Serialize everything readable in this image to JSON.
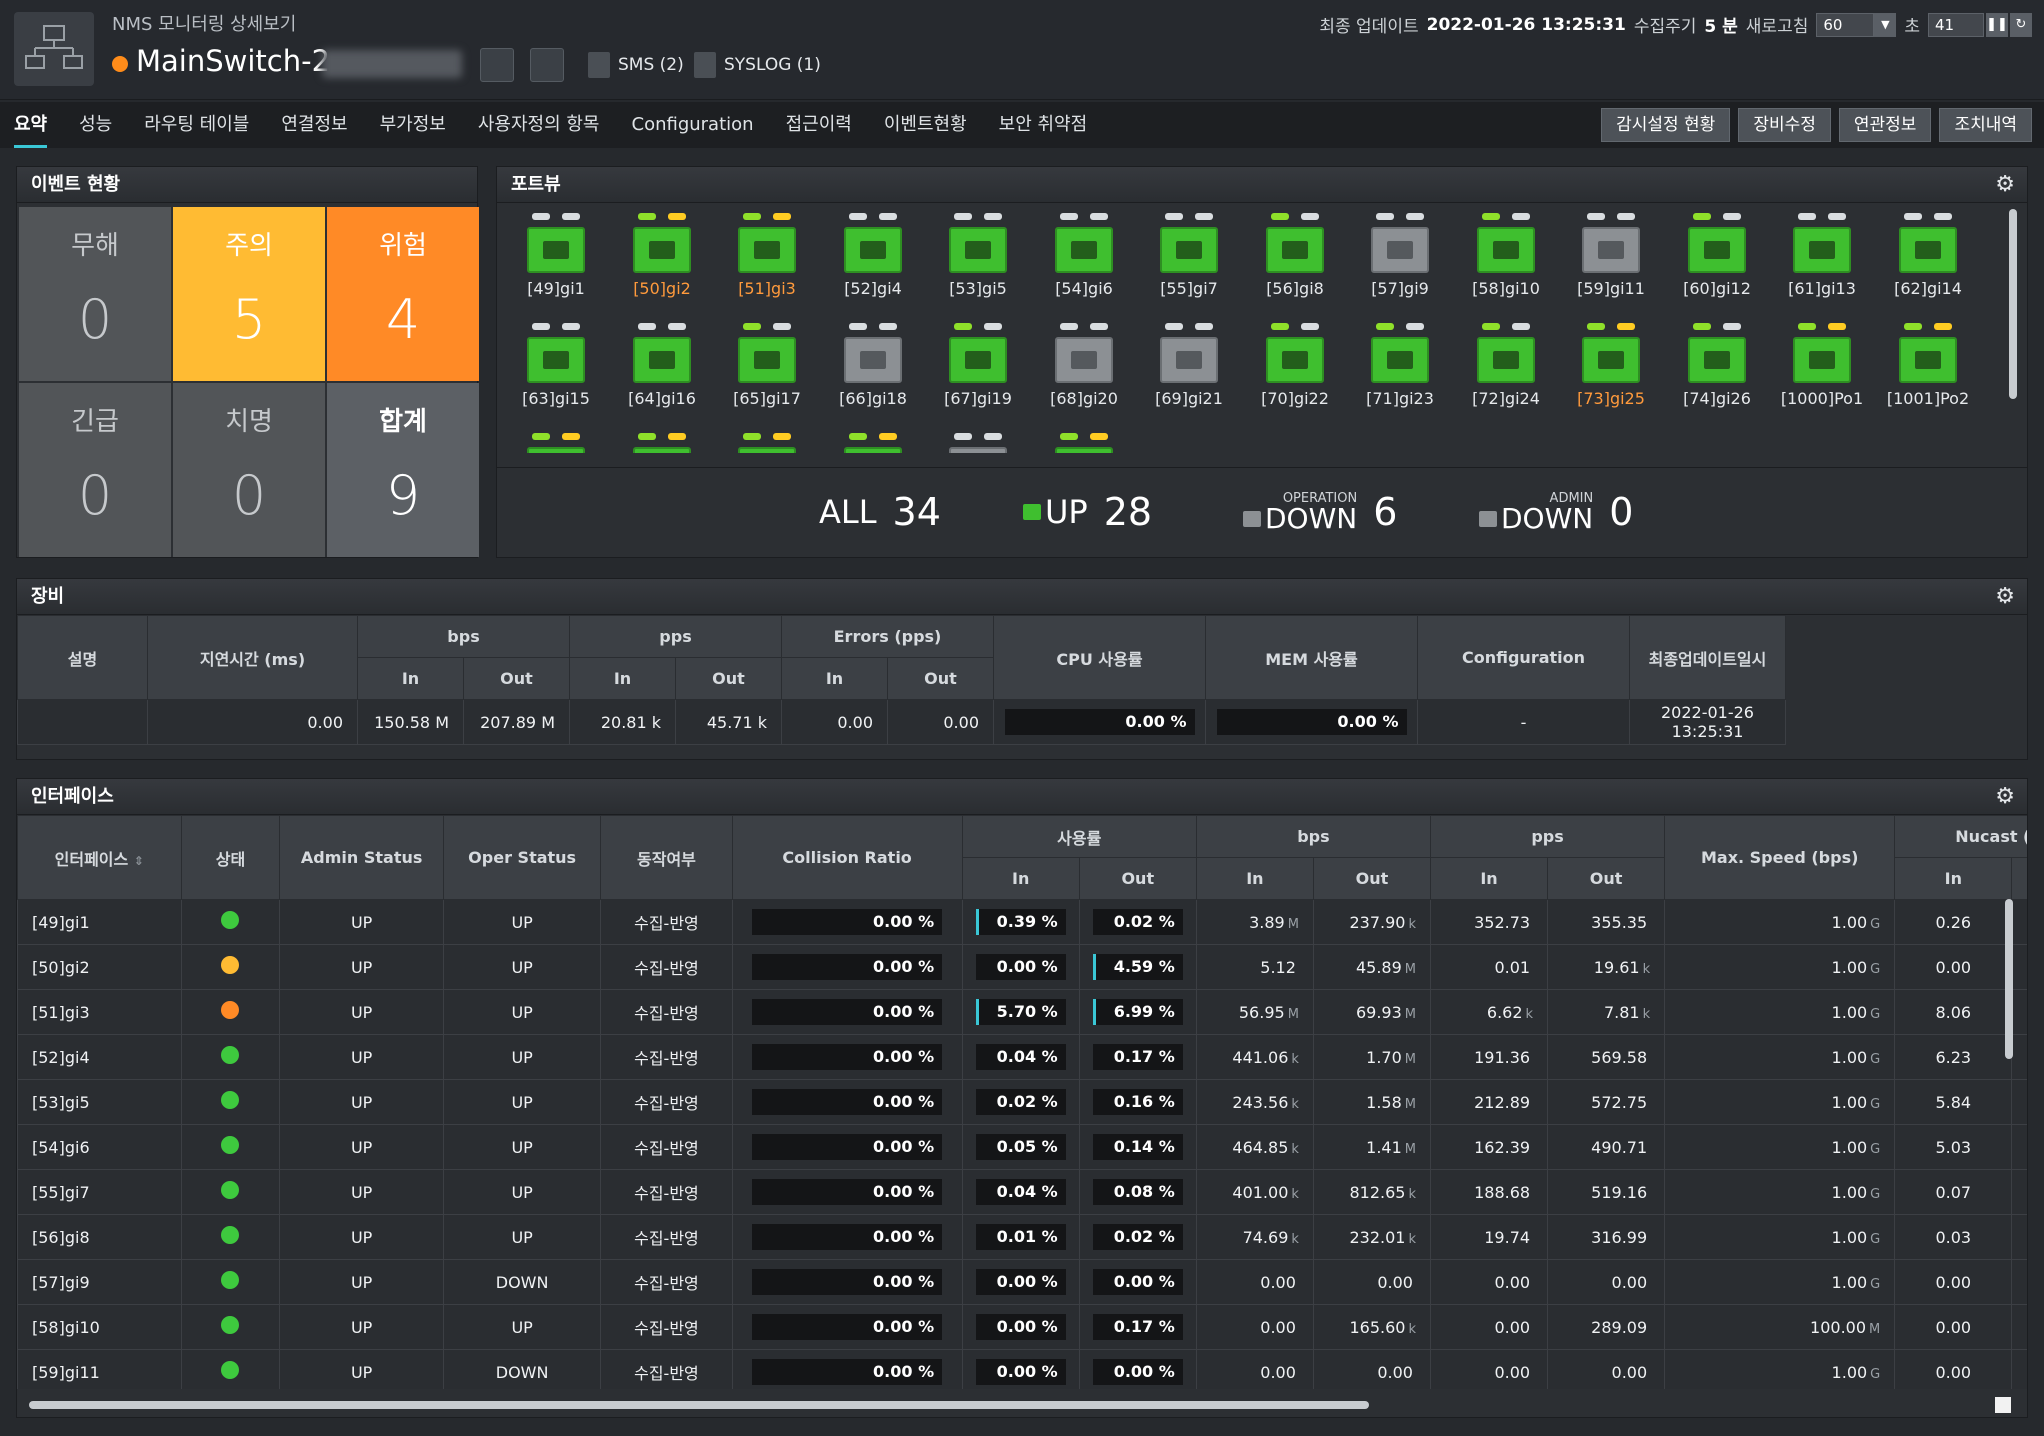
{
  "header": {
    "subtitle": "NMS 모니터링 상세보기",
    "device_name": "MainSwitch-2",
    "sms_label": "SMS (2)",
    "syslog_label": "SYSLOG (1)",
    "last_update_label": "최종 업데이트",
    "last_update_value": "2022-01-26 13:25:31",
    "collect_cycle_label": "수집주기",
    "collect_cycle_value": "5 분",
    "refresh_label": "새로고침",
    "refresh_value": "60",
    "seconds_label": "초",
    "countdown": "41",
    "status_color": "#ff8c1a"
  },
  "tabs": [
    {
      "label": "요약",
      "active": true
    },
    {
      "label": "성능"
    },
    {
      "label": "라우팅 테이블"
    },
    {
      "label": "연결정보"
    },
    {
      "label": "부가정보"
    },
    {
      "label": "사용자정의 항목"
    },
    {
      "label": "Configuration"
    },
    {
      "label": "접근이력"
    },
    {
      "label": "이벤트현황"
    },
    {
      "label": "보안 취약점"
    }
  ],
  "actions": [
    "감시설정 현황",
    "장비수정",
    "연관정보",
    "조치내역"
  ],
  "events": {
    "title": "이벤트 현황",
    "cells": [
      {
        "label": "무해",
        "value": "0"
      },
      {
        "label": "주의",
        "value": "5"
      },
      {
        "label": "위험",
        "value": "4"
      },
      {
        "label": "긴급",
        "value": "0"
      },
      {
        "label": "치명",
        "value": "0"
      },
      {
        "label": "합계",
        "value": "9"
      }
    ]
  },
  "portview": {
    "title": "포트뷰",
    "ports": [
      {
        "label": "[49]gi1",
        "leds": [
          "w",
          "w"
        ],
        "gray": false,
        "warn": false
      },
      {
        "label": "[50]gi2",
        "leds": [
          "g",
          "y"
        ],
        "gray": false,
        "warn": true
      },
      {
        "label": "[51]gi3",
        "leds": [
          "g",
          "y"
        ],
        "gray": false,
        "warn": true
      },
      {
        "label": "[52]gi4",
        "leds": [
          "w",
          "w"
        ],
        "gray": false,
        "warn": false
      },
      {
        "label": "[53]gi5",
        "leds": [
          "w",
          "w"
        ],
        "gray": false,
        "warn": false
      },
      {
        "label": "[54]gi6",
        "leds": [
          "w",
          "w"
        ],
        "gray": false,
        "warn": false
      },
      {
        "label": "[55]gi7",
        "leds": [
          "w",
          "w"
        ],
        "gray": false,
        "warn": false
      },
      {
        "label": "[56]gi8",
        "leds": [
          "g",
          "w"
        ],
        "gray": false,
        "warn": false
      },
      {
        "label": "[57]gi9",
        "leds": [
          "w",
          "w"
        ],
        "gray": true,
        "warn": false
      },
      {
        "label": "[58]gi10",
        "leds": [
          "g",
          "w"
        ],
        "gray": false,
        "warn": false
      },
      {
        "label": "[59]gi11",
        "leds": [
          "w",
          "w"
        ],
        "gray": true,
        "warn": false
      },
      {
        "label": "[60]gi12",
        "leds": [
          "g",
          "w"
        ],
        "gray": false,
        "warn": false
      },
      {
        "label": "[61]gi13",
        "leds": [
          "w",
          "w"
        ],
        "gray": false,
        "warn": false
      },
      {
        "label": "[62]gi14",
        "leds": [
          "w",
          "w"
        ],
        "gray": false,
        "warn": false
      },
      {
        "label": "[63]gi15",
        "leds": [
          "w",
          "w"
        ],
        "gray": false,
        "warn": false
      },
      {
        "label": "[64]gi16",
        "leds": [
          "w",
          "w"
        ],
        "gray": false,
        "warn": false
      },
      {
        "label": "[65]gi17",
        "leds": [
          "g",
          "w"
        ],
        "gray": false,
        "warn": false
      },
      {
        "label": "[66]gi18",
        "leds": [
          "w",
          "w"
        ],
        "gray": true,
        "warn": false
      },
      {
        "label": "[67]gi19",
        "leds": [
          "g",
          "w"
        ],
        "gray": false,
        "warn": false
      },
      {
        "label": "[68]gi20",
        "leds": [
          "w",
          "w"
        ],
        "gray": true,
        "warn": false
      },
      {
        "label": "[69]gi21",
        "leds": [
          "w",
          "w"
        ],
        "gray": true,
        "warn": false
      },
      {
        "label": "[70]gi22",
        "leds": [
          "g",
          "w"
        ],
        "gray": false,
        "warn": false
      },
      {
        "label": "[71]gi23",
        "leds": [
          "g",
          "w"
        ],
        "gray": false,
        "warn": false
      },
      {
        "label": "[72]gi24",
        "leds": [
          "g",
          "w"
        ],
        "gray": false,
        "warn": false
      },
      {
        "label": "[73]gi25",
        "leds": [
          "g",
          "y"
        ],
        "gray": false,
        "warn": true
      },
      {
        "label": "[74]gi26",
        "leds": [
          "g",
          "w"
        ],
        "gray": false,
        "warn": false
      },
      {
        "label": "[1000]Po1",
        "leds": [
          "g",
          "y"
        ],
        "gray": false,
        "warn": false
      },
      {
        "label": "[1001]Po2",
        "leds": [
          "g",
          "y"
        ],
        "gray": false,
        "warn": false
      },
      {
        "label": "",
        "leds": [
          "g",
          "y"
        ],
        "gray": false,
        "warn": false
      },
      {
        "label": "",
        "leds": [
          "g",
          "y"
        ],
        "gray": false,
        "warn": false
      },
      {
        "label": "",
        "leds": [
          "g",
          "y"
        ],
        "gray": false,
        "warn": false
      },
      {
        "label": "",
        "leds": [
          "g",
          "y"
        ],
        "gray": false,
        "warn": false
      },
      {
        "label": "",
        "leds": [
          "w",
          "w"
        ],
        "gray": true,
        "warn": false
      },
      {
        "label": "",
        "leds": [
          "g",
          "y"
        ],
        "gray": false,
        "warn": false
      }
    ],
    "summary": {
      "all_label": "ALL",
      "all_value": "34",
      "up_label": "UP",
      "up_value": "28",
      "op_small": "OPERATION",
      "op_label": "DOWN",
      "op_value": "6",
      "admin_small": "ADMIN",
      "admin_label": "DOWN",
      "admin_value": "0"
    }
  },
  "equipment": {
    "title": "장비",
    "headers": {
      "desc": "설명",
      "latency": "지연시간 (ms)",
      "bps": "bps",
      "pps": "pps",
      "errors": "Errors (pps)",
      "in": "In",
      "out": "Out",
      "cpu": "CPU 사용률",
      "mem": "MEM 사용률",
      "config": "Configuration",
      "updated": "최종업데이트일시"
    },
    "row": {
      "desc": "",
      "latency": "0.00",
      "bps_in": "150.58 M",
      "bps_out": "207.89 M",
      "pps_in": "20.81 k",
      "pps_out": "45.71 k",
      "err_in": "0.00",
      "err_out": "0.00",
      "cpu": "0.00 %",
      "mem": "0.00 %",
      "config": "-",
      "updated": "2022-01-26 13:25:31"
    }
  },
  "interfaces": {
    "title": "인터페이스",
    "headers": {
      "iface": "인터페이스",
      "status": "상태",
      "admin": "Admin Status",
      "oper": "Oper Status",
      "action": "동작여부",
      "collision": "Collision Ratio",
      "usage": "사용률",
      "bps": "bps",
      "pps": "pps",
      "maxspeed": "Max. Speed (bps)",
      "nucast": "Nucast (p",
      "in": "In",
      "out": "Out"
    },
    "sort_icon": "sort-arrows-icon",
    "rows": [
      {
        "name": "[49]gi1",
        "status": "#3ec93e",
        "admin": "UP",
        "oper": "UP",
        "action": "수집-반영",
        "collision": "0.00 %",
        "use_in": "0.39 %",
        "use_in_pct": 0.39,
        "use_out": "0.02 %",
        "use_out_pct": 0.02,
        "bps_in": "3.89",
        "bps_in_u": "M",
        "bps_out": "237.90",
        "bps_out_u": "k",
        "pps_in": "352.73",
        "pps_in_u": "",
        "pps_out": "355.35",
        "pps_out_u": "",
        "max": "1.00",
        "max_u": "G",
        "nucast_in": "0.26"
      },
      {
        "name": "[50]gi2",
        "status": "#ffbb33",
        "admin": "UP",
        "oper": "UP",
        "action": "수집-반영",
        "collision": "0.00 %",
        "use_in": "0.00 %",
        "use_in_pct": 0,
        "use_out": "4.59 %",
        "use_out_pct": 4.59,
        "bps_in": "5.12",
        "bps_in_u": "",
        "bps_out": "45.89",
        "bps_out_u": "M",
        "pps_in": "0.01",
        "pps_in_u": "",
        "pps_out": "19.61",
        "pps_out_u": "k",
        "max": "1.00",
        "max_u": "G",
        "nucast_in": "0.00"
      },
      {
        "name": "[51]gi3",
        "status": "#ff8a26",
        "admin": "UP",
        "oper": "UP",
        "action": "수집-반영",
        "collision": "0.00 %",
        "use_in": "5.70 %",
        "use_in_pct": 5.7,
        "use_out": "6.99 %",
        "use_out_pct": 6.99,
        "bps_in": "56.95",
        "bps_in_u": "M",
        "bps_out": "69.93",
        "bps_out_u": "M",
        "pps_in": "6.62",
        "pps_in_u": "k",
        "pps_out": "7.81",
        "pps_out_u": "k",
        "max": "1.00",
        "max_u": "G",
        "nucast_in": "8.06"
      },
      {
        "name": "[52]gi4",
        "status": "#3ec93e",
        "admin": "UP",
        "oper": "UP",
        "action": "수집-반영",
        "collision": "0.00 %",
        "use_in": "0.04 %",
        "use_in_pct": 0.04,
        "use_out": "0.17 %",
        "use_out_pct": 0.17,
        "bps_in": "441.06",
        "bps_in_u": "k",
        "bps_out": "1.70",
        "bps_out_u": "M",
        "pps_in": "191.36",
        "pps_in_u": "",
        "pps_out": "569.58",
        "pps_out_u": "",
        "max": "1.00",
        "max_u": "G",
        "nucast_in": "6.23"
      },
      {
        "name": "[53]gi5",
        "status": "#3ec93e",
        "admin": "UP",
        "oper": "UP",
        "action": "수집-반영",
        "collision": "0.00 %",
        "use_in": "0.02 %",
        "use_in_pct": 0.02,
        "use_out": "0.16 %",
        "use_out_pct": 0.16,
        "bps_in": "243.56",
        "bps_in_u": "k",
        "bps_out": "1.58",
        "bps_out_u": "M",
        "pps_in": "212.89",
        "pps_in_u": "",
        "pps_out": "572.75",
        "pps_out_u": "",
        "max": "1.00",
        "max_u": "G",
        "nucast_in": "5.84"
      },
      {
        "name": "[54]gi6",
        "status": "#3ec93e",
        "admin": "UP",
        "oper": "UP",
        "action": "수집-반영",
        "collision": "0.00 %",
        "use_in": "0.05 %",
        "use_in_pct": 0.05,
        "use_out": "0.14 %",
        "use_out_pct": 0.14,
        "bps_in": "464.85",
        "bps_in_u": "k",
        "bps_out": "1.41",
        "bps_out_u": "M",
        "pps_in": "162.39",
        "pps_in_u": "",
        "pps_out": "490.71",
        "pps_out_u": "",
        "max": "1.00",
        "max_u": "G",
        "nucast_in": "5.03"
      },
      {
        "name": "[55]gi7",
        "status": "#3ec93e",
        "admin": "UP",
        "oper": "UP",
        "action": "수집-반영",
        "collision": "0.00 %",
        "use_in": "0.04 %",
        "use_in_pct": 0.04,
        "use_out": "0.08 %",
        "use_out_pct": 0.08,
        "bps_in": "401.00",
        "bps_in_u": "k",
        "bps_out": "812.65",
        "bps_out_u": "k",
        "pps_in": "188.68",
        "pps_in_u": "",
        "pps_out": "519.16",
        "pps_out_u": "",
        "max": "1.00",
        "max_u": "G",
        "nucast_in": "0.07"
      },
      {
        "name": "[56]gi8",
        "status": "#3ec93e",
        "admin": "UP",
        "oper": "UP",
        "action": "수집-반영",
        "collision": "0.00 %",
        "use_in": "0.01 %",
        "use_in_pct": 0.01,
        "use_out": "0.02 %",
        "use_out_pct": 0.02,
        "bps_in": "74.69",
        "bps_in_u": "k",
        "bps_out": "232.01",
        "bps_out_u": "k",
        "pps_in": "19.74",
        "pps_in_u": "",
        "pps_out": "316.99",
        "pps_out_u": "",
        "max": "1.00",
        "max_u": "G",
        "nucast_in": "0.03"
      },
      {
        "name": "[57]gi9",
        "status": "#3ec93e",
        "admin": "UP",
        "oper": "DOWN",
        "action": "수집-반영",
        "collision": "0.00 %",
        "use_in": "0.00 %",
        "use_in_pct": 0,
        "use_out": "0.00 %",
        "use_out_pct": 0,
        "bps_in": "0.00",
        "bps_in_u": "",
        "bps_out": "0.00",
        "bps_out_u": "",
        "pps_in": "0.00",
        "pps_in_u": "",
        "pps_out": "0.00",
        "pps_out_u": "",
        "max": "1.00",
        "max_u": "G",
        "nucast_in": "0.00"
      },
      {
        "name": "[58]gi10",
        "status": "#3ec93e",
        "admin": "UP",
        "oper": "UP",
        "action": "수집-반영",
        "collision": "0.00 %",
        "use_in": "0.00 %",
        "use_in_pct": 0,
        "use_out": "0.17 %",
        "use_out_pct": 0.17,
        "bps_in": "0.00",
        "bps_in_u": "",
        "bps_out": "165.60",
        "bps_out_u": "k",
        "pps_in": "0.00",
        "pps_in_u": "",
        "pps_out": "289.09",
        "pps_out_u": "",
        "max": "100.00",
        "max_u": "M",
        "nucast_in": "0.00"
      },
      {
        "name": "[59]gi11",
        "status": "#3ec93e",
        "admin": "UP",
        "oper": "DOWN",
        "action": "수집-반영",
        "collision": "0.00 %",
        "use_in": "0.00 %",
        "use_in_pct": 0,
        "use_out": "0.00 %",
        "use_out_pct": 0,
        "bps_in": "0.00",
        "bps_in_u": "",
        "bps_out": "0.00",
        "bps_out_u": "",
        "pps_in": "0.00",
        "pps_in_u": "",
        "pps_out": "0.00",
        "pps_out_u": "",
        "max": "1.00",
        "max_u": "G",
        "nucast_in": "0.00"
      }
    ]
  }
}
